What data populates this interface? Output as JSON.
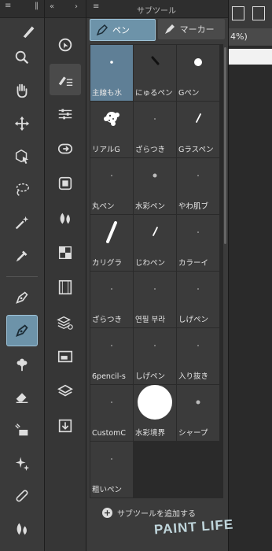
{
  "subpanel": {
    "title": "サブツール",
    "tabs": [
      {
        "label": "ペン",
        "icon": "pen-icon",
        "active": true
      },
      {
        "label": "マーカー",
        "icon": "marker-icon",
        "active": false
      }
    ],
    "items": [
      {
        "label": "主線も水",
        "preview": "dot-small"
      },
      {
        "label": "にゅるペン",
        "preview": "stroke-short"
      },
      {
        "label": "Gペン",
        "preview": "dot-medium"
      },
      {
        "label": "リアルG",
        "preview": "splatter"
      },
      {
        "label": "ざらつき",
        "preview": "dot-tiny"
      },
      {
        "label": "Gラスペン",
        "preview": "stroke-thin"
      },
      {
        "label": "丸ペン",
        "preview": "dot-tiny"
      },
      {
        "label": "水彩ペン",
        "preview": "dot-small-gray"
      },
      {
        "label": "やわ肌ブ",
        "preview": "dot-tiny"
      },
      {
        "label": "カリグラ",
        "preview": "stroke-long"
      },
      {
        "label": "じわペン",
        "preview": "stroke-thin"
      },
      {
        "label": "カラーイ",
        "preview": "dot-tiny"
      },
      {
        "label": "ざらつき",
        "preview": "dot-tiny"
      },
      {
        "label": "연필 부라",
        "preview": "dot-tiny"
      },
      {
        "label": "しげペン",
        "preview": "dot-tiny"
      },
      {
        "label": "6pencil-s",
        "preview": "dot-tiny"
      },
      {
        "label": "しげペン",
        "preview": "dot-tiny"
      },
      {
        "label": "入り抜き",
        "preview": "dot-tiny"
      },
      {
        "label": "CustomC",
        "preview": "dot-tiny"
      },
      {
        "label": "水彩境界",
        "preview": "circle-large"
      },
      {
        "label": "シャープ",
        "preview": "dot-small-gray"
      },
      {
        "label": "粗いペン",
        "preview": "dot-tiny"
      }
    ],
    "add_label": "サブツールを追加する",
    "active_index": 0
  },
  "canvas": {
    "zoom": "4%)"
  },
  "watermark": "PAINT LIFE",
  "tools": [
    "zoom-icon",
    "hand-icon",
    "move-icon",
    "object-select-icon",
    "lasso-icon",
    "magic-wand-icon",
    "eyedropper-icon",
    "pen-nib-icon",
    "pen-active-icon",
    "brush-flower-icon",
    "eraser-icon",
    "fill-icon",
    "sparkle-icon",
    "bandage-icon",
    "blend-icon"
  ],
  "groups": [
    "transform-icon",
    "pen-list-icon",
    "settings-sliders-icon",
    "navigator-icon",
    "layer-property-icon",
    "color-icon",
    "palette-grid-icon",
    "film-icon",
    "layer-stack-icon",
    "panel-icon",
    "layers-icon",
    "import-icon"
  ]
}
